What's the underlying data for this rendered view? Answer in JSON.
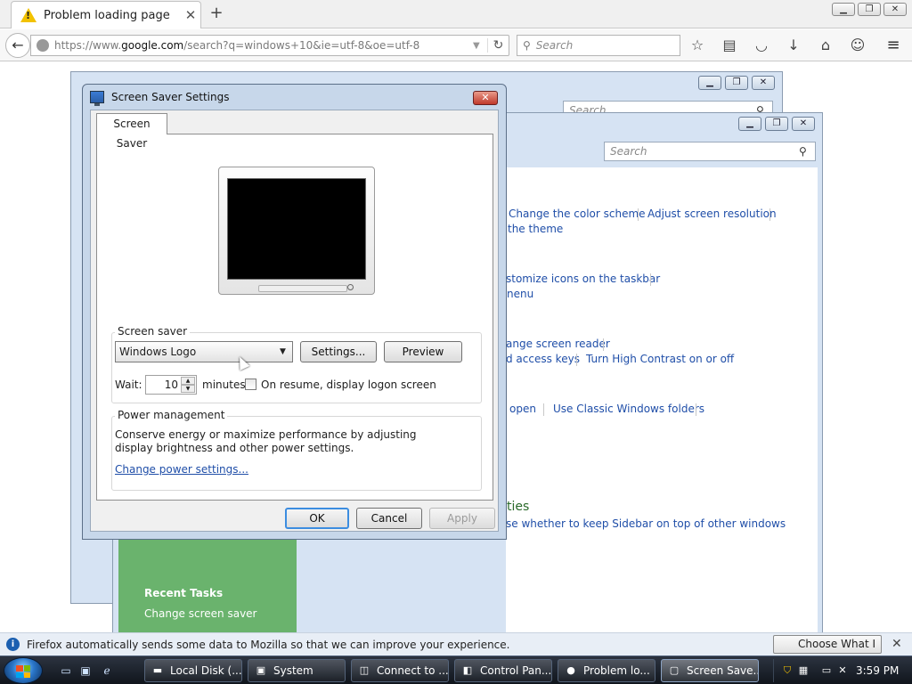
{
  "browser": {
    "tab_title": "Problem loading page",
    "tab_close": "✕",
    "new_tab": "+",
    "url_prefix": "https://www.",
    "url_domain": "google.com",
    "url_rest": "/search?q=windows+10&ie=utf-8&oe=utf-8",
    "search_placeholder": "Search"
  },
  "control_panel": {
    "search_placeholder_back": "Search",
    "search_placeholder_front": "Search",
    "links": [
      "Change the color scheme",
      "Adjust screen resolution",
      "the theme",
      "stomize icons on the taskbar",
      "nenu",
      "ange screen reader",
      "d access keys",
      "Turn High Contrast on or off",
      "open",
      "Use Classic Windows folders",
      "se whether to keep Sidebar on top of other windows"
    ],
    "heading_partial": "ties",
    "recent_tasks_title": "Recent Tasks",
    "recent_task": "Change screen saver"
  },
  "dialog": {
    "title": "Screen Saver Settings",
    "close": "✕",
    "tab": "Screen Saver",
    "screen_saver_group": "Screen saver",
    "screen_saver_value": "Windows Logo",
    "settings_button": "Settings...",
    "preview_button": "Preview",
    "wait_label": "Wait:",
    "wait_value": "10",
    "minutes_label": "minutes",
    "resume_label": "On resume, display logon screen",
    "resume_checked": false,
    "power_group": "Power management",
    "power_text": "Conserve energy or maximize performance by adjusting display brightness and other power settings.",
    "power_link": "Change power settings...",
    "ok": "OK",
    "cancel": "Cancel",
    "apply": "Apply"
  },
  "notification": {
    "message": "Firefox automatically sends some data to Mozilla so that we can improve your experience.",
    "share_button": "Choose What I Share"
  },
  "taskbar": {
    "buttons": [
      {
        "label": "Local Disk (...",
        "icon": "folder-icon"
      },
      {
        "label": "System",
        "icon": "system-icon"
      },
      {
        "label": "Connect to ...",
        "icon": "network-icon"
      },
      {
        "label": "Control Pan...",
        "icon": "control-panel-icon"
      },
      {
        "label": "Problem lo...",
        "icon": "firefox-icon"
      },
      {
        "label": "Screen Save...",
        "icon": "screen-saver-icon"
      }
    ],
    "clock": "3:59 PM"
  },
  "colors": {
    "link": "#1f4ea8",
    "green_panel": "#6ab36d",
    "dialog_frame": "#c7d7ea"
  }
}
